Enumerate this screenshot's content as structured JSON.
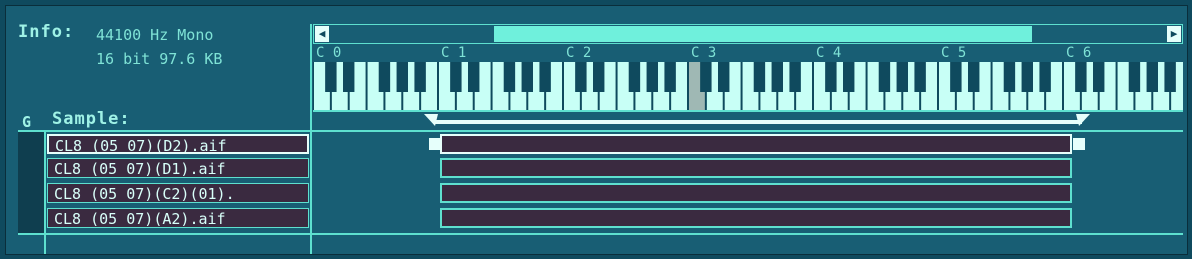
{
  "info": {
    "label": "Info:",
    "line1": "44100 Hz Mono",
    "line2": "16 bit 97.6 KB"
  },
  "sample_header": {
    "group": "G",
    "label": "Sample:"
  },
  "scrollbar": {
    "left_arrow": "◀",
    "right_arrow": "▶"
  },
  "octaves": [
    "C 0",
    "C 1",
    "C 2",
    "C 3",
    "C 4",
    "C 5",
    "C 6"
  ],
  "samples": [
    {
      "name": "CL8_(05_07)(D2).aif"
    },
    {
      "name": "CL8_(05_07)(D1).aif"
    },
    {
      "name": "CL8_(05_07)(C2)(01)."
    },
    {
      "name": "CL8_(05_07)(A2).aif"
    }
  ],
  "colors": {
    "background": "#185e74",
    "accent": "#5ee0cf",
    "zone_fill": "#3a2a40"
  }
}
